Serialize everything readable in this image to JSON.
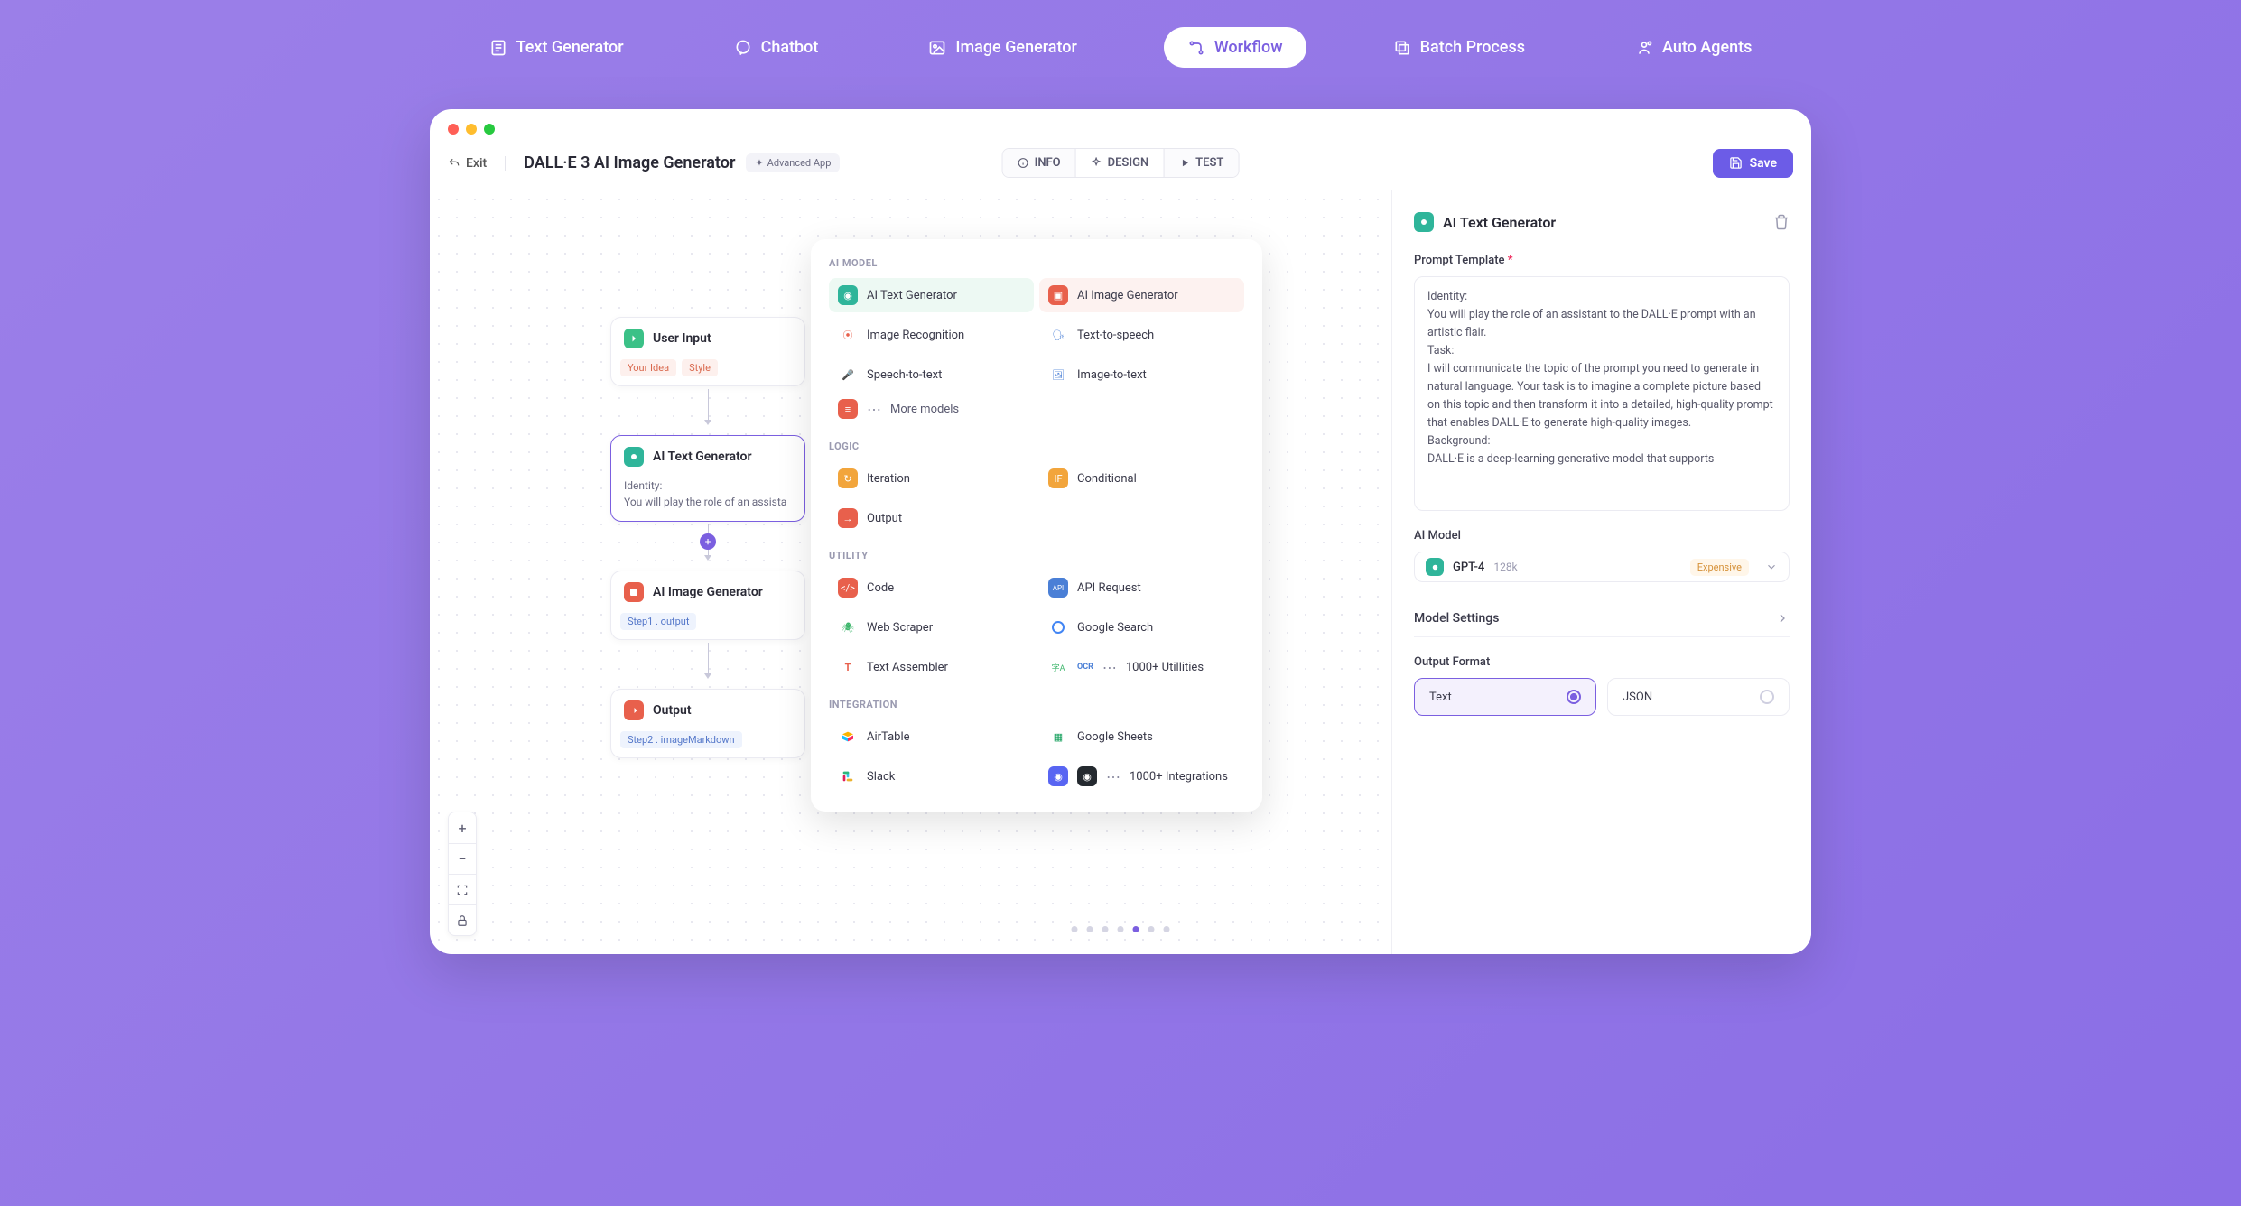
{
  "nav": {
    "items": [
      {
        "label": "Text Generator"
      },
      {
        "label": "Chatbot"
      },
      {
        "label": "Image Generator"
      },
      {
        "label": "Workflow"
      },
      {
        "label": "Batch Process"
      },
      {
        "label": "Auto Agents"
      }
    ]
  },
  "header": {
    "exit": "Exit",
    "title": "DALL·E 3 AI Image Generator",
    "badge": "Advanced App",
    "tabs": {
      "info": "INFO",
      "design": "DESIGN",
      "test": "TEST"
    },
    "save": "Save"
  },
  "nodes": {
    "userInput": {
      "title": "User Input",
      "tags": [
        "Your Idea",
        "Style"
      ]
    },
    "textGen": {
      "title": "AI Text Generator",
      "body1": "Identity:",
      "body2": "You will play the role of an assista"
    },
    "imageGen": {
      "title": "AI Image Generator",
      "tags": [
        "Step1 . output"
      ]
    },
    "output": {
      "title": "Output",
      "tags": [
        "Step2 . imageMarkdown"
      ]
    }
  },
  "palette": {
    "sections": {
      "aiModel": "AI MODEL",
      "logic": "LOGIC",
      "utility": "UTILITY",
      "integration": "INTEGRATION"
    },
    "aiModel": [
      {
        "label": "AI Text Generator"
      },
      {
        "label": "AI Image Generator"
      },
      {
        "label": "Image Recognition"
      },
      {
        "label": "Text-to-speech"
      },
      {
        "label": "Speech-to-text"
      },
      {
        "label": "Image-to-text"
      }
    ],
    "moreModels": "More models",
    "logic": [
      {
        "label": "Iteration"
      },
      {
        "label": "Conditional"
      },
      {
        "label": "Output"
      }
    ],
    "utility": [
      {
        "label": "Code"
      },
      {
        "label": "API Request"
      },
      {
        "label": "Web Scraper"
      },
      {
        "label": "Google Search"
      },
      {
        "label": "Text Assembler"
      }
    ],
    "moreUtilities": "1000+ Utillities",
    "integration": [
      {
        "label": "AirTable"
      },
      {
        "label": "Google Sheets"
      },
      {
        "label": "Slack"
      }
    ],
    "moreIntegrations": "1000+ Integrations"
  },
  "sidePanel": {
    "title": "AI Text Generator",
    "promptTemplate": {
      "label": "Prompt Template",
      "text": "Identity:\nYou will play the role of an assistant to the DALL·E prompt with an artistic flair.\nTask:\nI will communicate the topic of the prompt you need to generate in natural language. Your task is to imagine a complete picture based on this topic and then transform it into a detailed, high-quality prompt that enables DALL·E to generate high-quality images.\nBackground:\nDALL·E is a deep-learning generative model that supports"
    },
    "aiModel": {
      "label": "AI Model",
      "name": "GPT-4",
      "meta": "128k",
      "tag": "Expensive"
    },
    "modelSettings": "Model Settings",
    "outputFormat": {
      "label": "Output Format",
      "options": [
        "Text",
        "JSON"
      ]
    }
  }
}
